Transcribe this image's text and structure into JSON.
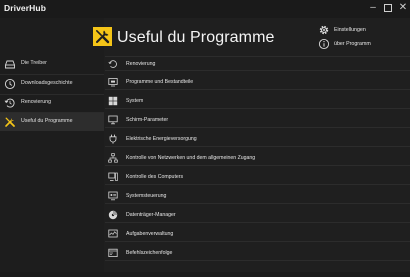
{
  "window": {
    "title": "DriverHub",
    "controls": {
      "minimize": "–",
      "maximize": "☐",
      "close": "✕"
    }
  },
  "sidebar": {
    "items": [
      {
        "label": "Die Treiber",
        "icon": "driver-tray-icon",
        "active": false
      },
      {
        "label": "Downloadsgeschichte",
        "icon": "clock-icon",
        "active": false
      },
      {
        "label": "Renovierung",
        "icon": "restore-icon",
        "active": false
      },
      {
        "label": "Useful du Programme",
        "icon": "tools-icon",
        "active": true
      }
    ]
  },
  "header": {
    "title": "Useful du Programme",
    "icon": "tools-icon",
    "accent_color": "#f5c518"
  },
  "top_right": {
    "settings_label": "Einstellungen",
    "about_label": "über Programm"
  },
  "tools": [
    {
      "label": "Renovierung",
      "icon": "restore-icon"
    },
    {
      "label": "Programme und Bestandteile",
      "icon": "programs-icon"
    },
    {
      "label": "System",
      "icon": "windows-icon"
    },
    {
      "label": "Schirm-Parameter",
      "icon": "monitor-icon"
    },
    {
      "label": "Elektrische Energieversorgung",
      "icon": "plug-icon"
    },
    {
      "label": "Kontrolle von Netzwerken und dem allgemeinen Zugang",
      "icon": "network-icon"
    },
    {
      "label": "Kontrolle des Computers",
      "icon": "computer-icon"
    },
    {
      "label": "Systemsteuerung",
      "icon": "control-panel-icon"
    },
    {
      "label": "Datenträger-Manager",
      "icon": "disk-icon"
    },
    {
      "label": "Aufgabenverwaltung",
      "icon": "task-manager-icon"
    },
    {
      "label": "Befehlszeichenfolge",
      "icon": "terminal-icon"
    }
  ]
}
